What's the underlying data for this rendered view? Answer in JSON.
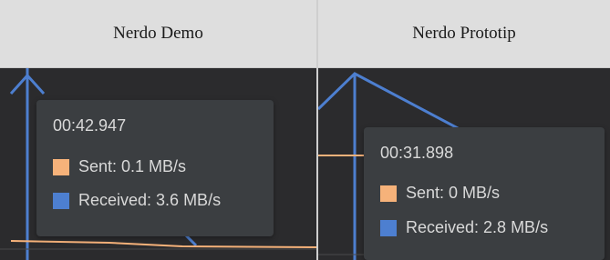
{
  "panels": {
    "left": {
      "title": "Nerdo Demo",
      "tooltip": {
        "time": "00:42.947",
        "sent": "Sent: 0.1 MB/s",
        "received": "Received: 3.6 MB/s"
      }
    },
    "right": {
      "title": "Nerdo Prototip",
      "tooltip": {
        "time": "00:31.898",
        "sent": "Sent: 0 MB/s",
        "received": "Received: 2.8 MB/s"
      }
    }
  },
  "colors": {
    "received": "#4d7fd0",
    "sent": "#f6b27a",
    "plot_bg": "#2b2b2d"
  }
}
